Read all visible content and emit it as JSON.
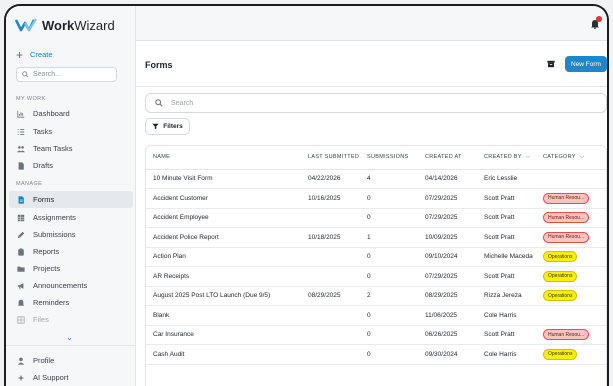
{
  "app": {
    "brand_bold": "Work",
    "brand_light": "Wizard",
    "accent_color": "#1d88c9"
  },
  "sidebar": {
    "create_label": "Create",
    "search_placeholder": "Search...",
    "my_work_label": "MY WORK",
    "manage_label": "MANAGE",
    "my_work_items": [
      {
        "label": "Dashboard",
        "icon": "chart-icon"
      },
      {
        "label": "Tasks",
        "icon": "tasks-icon"
      },
      {
        "label": "Team Tasks",
        "icon": "team-icon"
      },
      {
        "label": "Drafts",
        "icon": "file-icon"
      }
    ],
    "manage_items": [
      {
        "label": "Forms",
        "icon": "form-icon",
        "active": true
      },
      {
        "label": "Assignments",
        "icon": "grid-icon"
      },
      {
        "label": "Submissions",
        "icon": "pen-icon"
      },
      {
        "label": "Reports",
        "icon": "clipboard-icon"
      },
      {
        "label": "Projects",
        "icon": "folder-icon"
      },
      {
        "label": "Announcements",
        "icon": "megaphone-icon"
      },
      {
        "label": "Reminders",
        "icon": "bell-icon"
      },
      {
        "label": "Files",
        "icon": "files-icon"
      }
    ],
    "bottom_items": [
      {
        "label": "Profile",
        "icon": "user-icon"
      },
      {
        "label": "AI Support",
        "icon": "sparkle-icon"
      }
    ]
  },
  "page": {
    "title": "Forms",
    "new_form_label": "New Form",
    "search_placeholder": "Search",
    "filters_label": "Filters"
  },
  "table": {
    "columns": [
      "NAME",
      "LAST SUBMITTED",
      "SUBMISSIONS",
      "CREATED AT",
      "CREATED BY",
      "CATEGORY"
    ],
    "rows": [
      {
        "name": "10 Minute Visit Form",
        "last_submitted": "04/22/2026",
        "submissions": "4",
        "created_at": "04/14/2026",
        "created_by": "Eric Lesslie",
        "category": ""
      },
      {
        "name": "Accident Customer",
        "last_submitted": "10/16/2025",
        "submissions": "0",
        "created_at": "07/29/2025",
        "created_by": "Scott Pratt",
        "category": "Human Resou..."
      },
      {
        "name": "Accident Employee",
        "last_submitted": "",
        "submissions": "0",
        "created_at": "07/29/2025",
        "created_by": "Scott Pratt",
        "category": "Human Resou..."
      },
      {
        "name": "Accident Police Report",
        "last_submitted": "10/18/2025",
        "submissions": "1",
        "created_at": "10/09/2025",
        "created_by": "Scott Pratt",
        "category": "Human Resou..."
      },
      {
        "name": "Action Plan",
        "last_submitted": "",
        "submissions": "0",
        "created_at": "09/10/2024",
        "created_by": "Michelle Maceda",
        "category": "Operations"
      },
      {
        "name": "AR Receipts",
        "last_submitted": "",
        "submissions": "0",
        "created_at": "07/29/2025",
        "created_by": "Scott Pratt",
        "category": "Operations"
      },
      {
        "name": "August 2025 Post LTO Launch (Due 9/5)",
        "last_submitted": "08/29/2025",
        "submissions": "2",
        "created_at": "08/29/2025",
        "created_by": "Rizza Jereza",
        "category": "Operations"
      },
      {
        "name": "Blank",
        "last_submitted": "",
        "submissions": "0",
        "created_at": "11/06/2025",
        "created_by": "Cole Harris",
        "category": ""
      },
      {
        "name": "Car Insurance",
        "last_submitted": "",
        "submissions": "0",
        "created_at": "06/26/2025",
        "created_by": "Scott Pratt",
        "category": "Human Resou..."
      },
      {
        "name": "Cash Audit",
        "last_submitted": "",
        "submissions": "0",
        "created_at": "09/30/2024",
        "created_by": "Cole Harris",
        "category": "Operations"
      }
    ]
  }
}
